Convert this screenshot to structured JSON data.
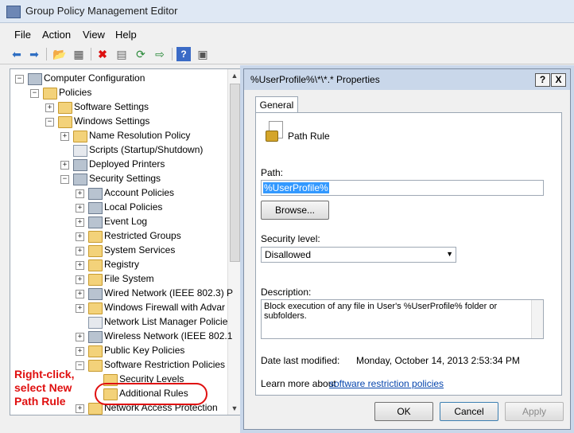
{
  "app": {
    "title": "Group Policy Management Editor"
  },
  "menu": [
    "File",
    "Action",
    "View",
    "Help"
  ],
  "tree": [
    {
      "label": "Computer Configuration",
      "level": 0,
      "exp": "−",
      "icon": "computer"
    },
    {
      "label": "Policies",
      "level": 1,
      "exp": "−",
      "icon": "folder"
    },
    {
      "label": "Software Settings",
      "level": 2,
      "exp": "+",
      "icon": "folder"
    },
    {
      "label": "Windows Settings",
      "level": 2,
      "exp": "−",
      "icon": "folder"
    },
    {
      "label": "Name Resolution Policy",
      "level": 3,
      "exp": "+",
      "icon": "folder"
    },
    {
      "label": "Scripts (Startup/Shutdown)",
      "level": 3,
      "exp": "",
      "icon": "doc"
    },
    {
      "label": "Deployed Printers",
      "level": 3,
      "exp": "+",
      "icon": "printer"
    },
    {
      "label": "Security Settings",
      "level": 3,
      "exp": "−",
      "icon": "security"
    },
    {
      "label": "Account Policies",
      "level": 4,
      "exp": "+",
      "icon": "gear"
    },
    {
      "label": "Local Policies",
      "level": 4,
      "exp": "+",
      "icon": "gear"
    },
    {
      "label": "Event Log",
      "level": 4,
      "exp": "+",
      "icon": "gear"
    },
    {
      "label": "Restricted Groups",
      "level": 4,
      "exp": "+",
      "icon": "folder"
    },
    {
      "label": "System Services",
      "level": 4,
      "exp": "+",
      "icon": "folder"
    },
    {
      "label": "Registry",
      "level": 4,
      "exp": "+",
      "icon": "folder"
    },
    {
      "label": "File System",
      "level": 4,
      "exp": "+",
      "icon": "folder"
    },
    {
      "label": "Wired Network (IEEE 802.3) P",
      "level": 4,
      "exp": "+",
      "icon": "gear"
    },
    {
      "label": "Windows Firewall with Advar",
      "level": 4,
      "exp": "+",
      "icon": "folder"
    },
    {
      "label": "Network List Manager Policie",
      "level": 4,
      "exp": "",
      "icon": "doc"
    },
    {
      "label": "Wireless Network (IEEE 802.1",
      "level": 4,
      "exp": "+",
      "icon": "gear"
    },
    {
      "label": "Public Key Policies",
      "level": 4,
      "exp": "+",
      "icon": "folder"
    },
    {
      "label": "Software Restriction Policies",
      "level": 4,
      "exp": "−",
      "icon": "folder"
    },
    {
      "label": "Security Levels",
      "level": 5,
      "exp": "",
      "icon": "folder"
    },
    {
      "label": "Additional Rules",
      "level": 5,
      "exp": "",
      "icon": "folder"
    },
    {
      "label": "Network Access Protection",
      "level": 4,
      "exp": "+",
      "icon": "folder"
    }
  ],
  "annotation": "Right-click, select New Path Rule",
  "dialog": {
    "title": "%UserProfile%\\*\\*.* Properties",
    "help": "?",
    "close": "X",
    "tab": "General",
    "rule_name": "Path Rule",
    "path_label": "Path:",
    "path_value": "%UserProfile%",
    "browse": "Browse...",
    "security_label": "Security level:",
    "security_value": "Disallowed",
    "description_label": "Description:",
    "description_value": "Block execution of any file in User's %UserProfile% folder or subfolders.",
    "date_label": "Date last modified:",
    "date_value": "Monday, October 14, 2013  2:53:34 PM",
    "learn_prefix": "Learn more about",
    "learn_link": "software restriction policies",
    "ok": "OK",
    "cancel": "Cancel",
    "apply": "Apply"
  }
}
